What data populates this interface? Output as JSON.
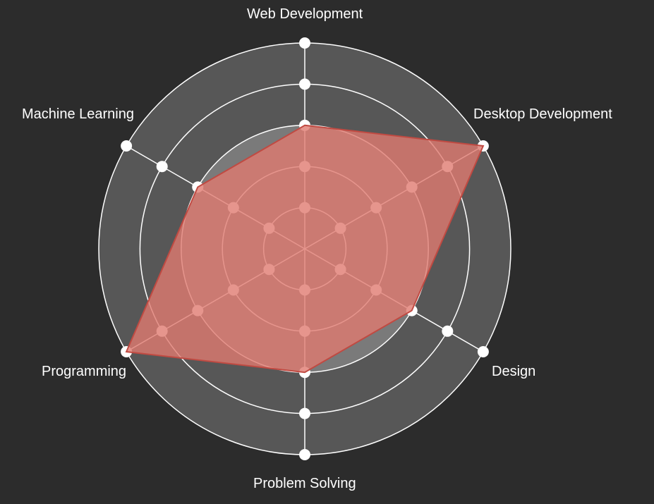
{
  "colors": {
    "background": "#2c2c2c",
    "ring_outer": "#575757",
    "ring_inner": "#7a7a7a",
    "ring_stroke": "#ffffff",
    "series_fill": "#e07a70",
    "series_stroke": "#c04a42",
    "label": "#ffffff"
  },
  "chart_data": {
    "type": "radar",
    "axes": [
      "Web Development",
      "Desktop Development",
      "Design",
      "Problem Solving",
      "Programming",
      "Machine Learning"
    ],
    "levels": 5,
    "max": 5,
    "series": [
      {
        "values": [
          3,
          5,
          3,
          3,
          5,
          3
        ]
      }
    ],
    "grid": "circular",
    "legend": "none"
  }
}
